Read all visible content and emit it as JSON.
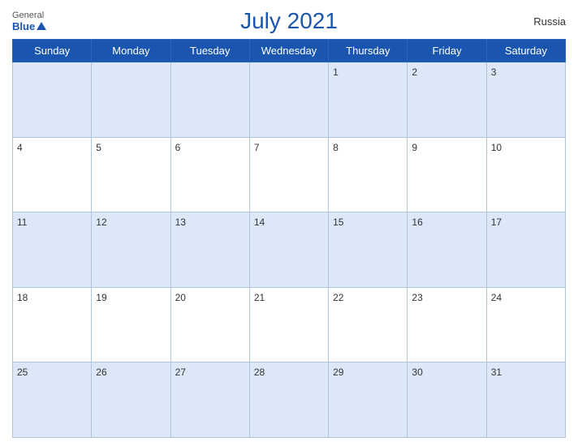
{
  "header": {
    "title": "July 2021",
    "country": "Russia",
    "logo": {
      "general": "General",
      "blue": "Blue"
    }
  },
  "days_of_week": [
    "Sunday",
    "Monday",
    "Tuesday",
    "Wednesday",
    "Thursday",
    "Friday",
    "Saturday"
  ],
  "weeks": [
    [
      null,
      null,
      null,
      null,
      "1",
      "2",
      "3"
    ],
    [
      "4",
      "5",
      "6",
      "7",
      "8",
      "9",
      "10"
    ],
    [
      "11",
      "12",
      "13",
      "14",
      "15",
      "16",
      "17"
    ],
    [
      "18",
      "19",
      "20",
      "21",
      "22",
      "23",
      "24"
    ],
    [
      "25",
      "26",
      "27",
      "28",
      "29",
      "30",
      "31"
    ]
  ]
}
